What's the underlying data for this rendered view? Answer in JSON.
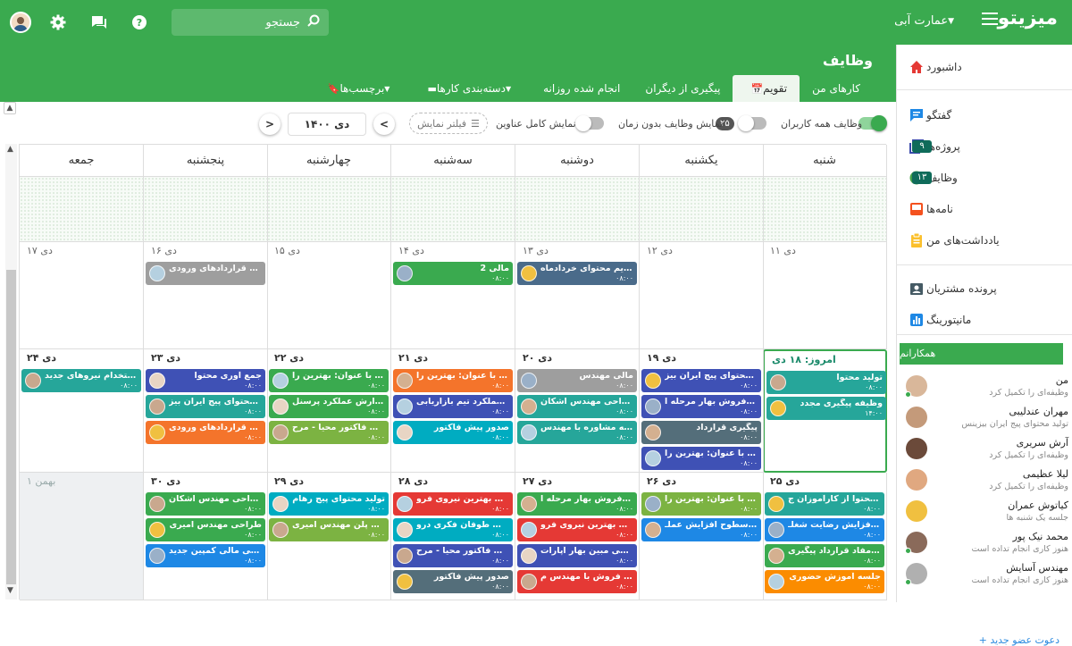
{
  "topbar": {
    "brand": "میزیتو",
    "org": "عمارت آبی",
    "search_placeholder": "جستجو",
    "icons": [
      "menu-icon",
      "search-icon",
      "help-icon",
      "chat-icon",
      "gear-icon",
      "user-avatar"
    ]
  },
  "sidebar": {
    "items": [
      {
        "label": "داشبورد",
        "icon": "home-icon",
        "color": "#e53935"
      },
      {
        "label": "گفتگو",
        "icon": "chat-icon",
        "color": "#1e88e5"
      },
      {
        "label": "پروژه‌ها",
        "icon": "projects-icon",
        "color": "#3949ab",
        "badge": "۹"
      },
      {
        "label": "وظایف",
        "icon": "tasks-icon",
        "color": "#43a047",
        "badge": "۱۳"
      },
      {
        "label": "نامه‌ها",
        "icon": "mail-icon",
        "color": "#f4511e"
      },
      {
        "label": "یادداشت‌های من",
        "icon": "notes-icon",
        "color": "#fbc02d"
      },
      {
        "label": "پرونده مشتریان",
        "icon": "customers-icon",
        "color": "#455a64"
      },
      {
        "label": "مانیتورینگ",
        "icon": "monitoring-icon",
        "color": "#1e88e5"
      }
    ],
    "colleagues_title": "همکارانم",
    "colleagues": [
      {
        "name": "من",
        "status": "وظیفه‌ای را تکمیل کرد",
        "online": true
      },
      {
        "name": "مهران عندلیبی",
        "status": "تولید محتوای پیج ایران بیزینس",
        "online": false
      },
      {
        "name": "آرش سریری",
        "status": "وظیفه‌ای را تکمیل کرد",
        "online": false
      },
      {
        "name": "لیلا عظیمی",
        "status": "وظیفه‌ای را تکمیل کرد",
        "online": false
      },
      {
        "name": "کیاتوش عمران",
        "status": "جلسه یک شنبه ها",
        "online": false
      },
      {
        "name": "محمد نیک پور",
        "status": "هنوز کاری انجام تداده است",
        "online": true
      },
      {
        "name": "مهندس آسایش",
        "status": "هنوز کاری انجام تداده است",
        "online": true
      }
    ],
    "invite": "+ دعوت عضو جدید"
  },
  "main": {
    "title": "وظایف",
    "tabs": [
      {
        "label": "کارهای من",
        "active": false
      },
      {
        "label": "تقویم",
        "active": true
      },
      {
        "label": "پیگیری از دیگران",
        "active": false
      },
      {
        "label": "انجام شده روزانه",
        "active": false
      },
      {
        "label": "دسته‌بندی کارها",
        "active": false
      },
      {
        "label": "برچسب‌ها",
        "active": false
      }
    ],
    "filters": {
      "all_users": "وظایف همه کاربران",
      "no_time_count": "۲۵",
      "no_time": "نمایش وظایف بدون زمان",
      "full_titles": "نمایش کامل عناوین",
      "filter_btn": "فیلتر نمایش",
      "month": "دی ۱۴۰۰",
      "prev": "<",
      "next": ">"
    }
  },
  "calendar": {
    "days": [
      "شنبه",
      "یکشنبه",
      "دوشنبه",
      "سه‌شنبه",
      "چهارشنبه",
      "پنجشنبه",
      "جمعه"
    ],
    "weeks": [
      {
        "cells": [
          {
            "date": "۱۱ دی",
            "events": []
          },
          {
            "date": "۱۲ دی",
            "events": []
          },
          {
            "date": "۱۳ دی",
            "events": [
              {
                "title": "تقویم محتوای خردادماه",
                "time": "۰۸:۰۰",
                "color": "#4a6b8a"
              }
            ]
          },
          {
            "date": "۱۴ دی",
            "events": [
              {
                "title": "مالی 2",
                "time": "۰۸:۰۰",
                "color": "#3aaa4f"
              }
            ]
          },
          {
            "date": "۱۵ دی",
            "events": []
          },
          {
            "date": "۱۶ دی",
            "events": [
              {
                "title": "بررسی قراردادهای ورودی",
                "time": "",
                "color": "#9e9e9e"
              }
            ]
          },
          {
            "date": "۱۷ دی",
            "events": []
          }
        ]
      },
      {
        "cells": [
          {
            "date": "امروز: ۱۸ دی",
            "today": true,
            "events": [
              {
                "title": "تولید محتوا",
                "time": "۰۸:۰۰",
                "color": "#26a69a"
              },
              {
                "title": "وظیفه پیگیری مجدد",
                "time": "۱۴:۰۰",
                "color": "#26a69a"
              }
            ]
          },
          {
            "date": "۱۹ دی",
            "events": [
              {
                "title": "تولید محتوای پیج ایران بیز...",
                "time": "۰۸:۰۰",
                "color": "#3f51b5"
              },
              {
                "title": "کمپین فروش بهار مرحله ا...",
                "time": "۰۸:۰۰",
                "color": "#3f51b5"
              },
              {
                "title": "پیگیری قرارداد",
                "time": "۰۸:۰۰",
                "color": "#546e7a"
              },
              {
                "title": "مقاله با عنوان: بهترین را...",
                "time": "۰۸:۰۰",
                "color": "#3f51b5"
              }
            ]
          },
          {
            "date": "۲۰ دی",
            "events": [
              {
                "title": "مالی مهندس",
                "time": "۰۸:۰۰",
                "color": "#9e9e9e"
              },
              {
                "title": "طراحی مهندس اشکان",
                "time": "۰۸:۰۰",
                "color": "#26a69a"
              },
              {
                "title": "جلسه مشاوره با مهندس ...",
                "time": "۰۸:۰۰",
                "color": "#26a69a"
              }
            ]
          },
          {
            "date": "۲۱ دی",
            "events": [
              {
                "title": "مقاله با عنوان: بهترین را...",
                "time": "۰۸:۰۰",
                "color": "#f4742b"
              },
              {
                "title": "گزارش عملکرد تیم بازاریابی",
                "time": "۰۸:۰۰",
                "color": "#3f51b5"
              },
              {
                "title": "صدور پیش فاکتور",
                "time": "۰۸:۰۰",
                "color": "#00acc1"
              }
            ]
          },
          {
            "date": "۲۲ دی",
            "events": [
              {
                "title": "مقاله با عنوان: بهترین را...",
                "time": "۰۸:۰۰",
                "color": "#3aaa4f"
              },
              {
                "title": "گزارش عملکرد پرسنل",
                "time": "۰۸:۰۰",
                "color": "#3aaa4f"
              },
              {
                "title": "پیگیری فاکتور محیا - مرح...",
                "time": "۰۸:۰۰",
                "color": "#7cb342"
              }
            ]
          },
          {
            "date": "۲۳ دی",
            "events": [
              {
                "title": "جمع آوری محتوا",
                "time": "۰۸:۰۰",
                "color": "#3f51b5"
              },
              {
                "title": "تولید محتوای پیج ایران بیز...",
                "time": "۰۸:۰۰",
                "color": "#26a69a"
              },
              {
                "title": "بررسی قراردادهای ورودی",
                "time": "۰۸:۰۰",
                "color": "#f4742b"
              }
            ]
          },
          {
            "date": "۲۴ دی",
            "events": [
              {
                "title": "استخدام نیروهای جدید",
                "time": "۰۸:۰۰",
                "color": "#26a69a"
              }
            ]
          }
        ]
      },
      {
        "cells": [
          {
            "date": "۲۵ دی",
            "events": [
              {
                "title": "آزمون محتوا از کارآموزان ج...",
                "time": "۰۸:۰۰",
                "color": "#26a69a"
              },
              {
                "title": "طرح افزایش رضایت شغلـ...",
                "time": "۰۸:۰۰",
                "color": "#1e88e5"
              },
              {
                "title": "لغو مفاد قرارداد پیگیری ...",
                "time": "۰۸:۰۰",
                "color": "#3aaa4f"
              },
              {
                "title": "جلسه آموزش حضوری",
                "time": "۰۸:۰۰",
                "color": "#fb8c00"
              }
            ]
          },
          {
            "date": "۲۶ دی",
            "events": [
              {
                "title": "مقاله با عنوان: بهترین را...",
                "time": "۰۸:۰۰",
                "color": "#7cb342"
              },
              {
                "title": "بررسی سطوح افزایش عملـ...",
                "time": "۰۸:۰۰",
                "color": "#1e88e5"
              }
            ]
          },
          {
            "date": "۲۷ دی",
            "events": [
              {
                "title": "کمپین فروش بهار مرحله ا...",
                "time": "۰۸:۰۰",
                "color": "#3aaa4f"
              },
              {
                "title": "انتخاب بهترین نیروی فرو...",
                "time": "۰۸:۰۰",
                "color": "#e53935"
              },
              {
                "title": "بررسی مبین بهار آپارات",
                "time": "۰۸:۰۰",
                "color": "#3f51b5"
              },
              {
                "title": "جلسه فروش با مهندس م...",
                "time": "۰۸:۰۰",
                "color": "#e53935"
              }
            ]
          },
          {
            "date": "۲۸ دی",
            "events": [
              {
                "title": "انتخاب بهترین نیروی فرو...",
                "time": "۰۸:۰۰",
                "color": "#e53935"
              },
              {
                "title": "جلسات طوفان فکری درو...",
                "time": "۰۸:۰۰",
                "color": "#00acc1"
              },
              {
                "title": "پیگیری فاکتور محیا - مرح...",
                "time": "۰۸:۰۰",
                "color": "#3f51b5"
              },
              {
                "title": "صدور پیش فاکتور",
                "time": "۰۸:۰۰",
                "color": "#546e7a"
              }
            ]
          },
          {
            "date": "۲۹ دی",
            "events": [
              {
                "title": "تولید محتوای پیج رهام",
                "time": "۰۸:۰۰",
                "color": "#00acc1"
              },
              {
                "title": "طراحی پلن مهندس امیری",
                "time": "۰۸:۰۰",
                "color": "#7cb342"
              }
            ]
          },
          {
            "date": "۳۰ دی",
            "events": [
              {
                "title": "طراحی مهندس اشکان",
                "time": "۰۸:۰۰",
                "color": "#3aaa4f"
              },
              {
                "title": "طراحی مهندس امیری",
                "time": "۰۸:۰۰",
                "color": "#3aaa4f"
              },
              {
                "title": "بررسی مالی کمپین جدید ...",
                "time": "۰۸:۰۰",
                "color": "#1e88e5"
              }
            ]
          },
          {
            "date": "۱ بهمن",
            "muted": true,
            "events": []
          }
        ]
      }
    ]
  }
}
